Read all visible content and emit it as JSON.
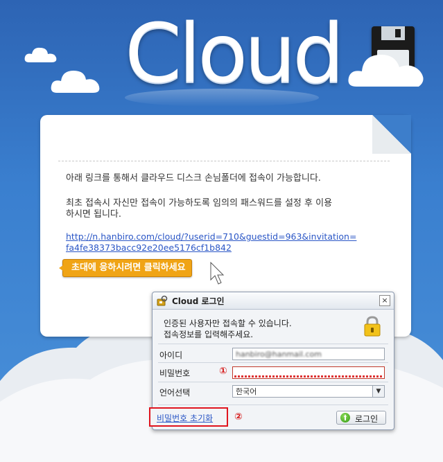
{
  "hero": {
    "title": "Cloud"
  },
  "panel": {
    "line1": "아래 링크를 통해서 클라우드 디스크 손님폴더에 접속이 가능합니다.",
    "line2": "최초 접속시 자신만 접속이 가능하도록 임의의 패스워드를 설정 후 이용",
    "line3": "하시면 됩니다.",
    "link_line1": "http://n.hanbiro.com/cloud/?userid=710&guestid=963&invitation=",
    "link_line2": "fa4fe38373bacc92e20ee5176cf1b842",
    "tooltip": "초대에 응하시려면 클릭하세요"
  },
  "dialog": {
    "title": "Cloud 로그인",
    "notice_line1": "인증된 사용자만 접속할 수 있습니다.",
    "notice_line2": "접속정보를 입력해주세요.",
    "id_label": "아이디",
    "id_value": "hanbiro@hanmail.com",
    "password_label": "비밀번호",
    "password_value": "",
    "language_label": "언어선택",
    "language_value": "한국어",
    "reset_link": "비밀번호 초기화",
    "login_button": "로그인",
    "close_symbol": "×",
    "select_arrow": "▼",
    "marker1": "①",
    "marker2": "②"
  },
  "icons": [
    "floppy-disk-icon",
    "cloud-icon",
    "lock-icon",
    "key-icon",
    "close-icon",
    "login-icon",
    "cursor-icon"
  ],
  "colors": {
    "background": "#2f6fbf",
    "accent": "#f0a415",
    "marker": "#e0141e",
    "link": "#2a56c6"
  }
}
